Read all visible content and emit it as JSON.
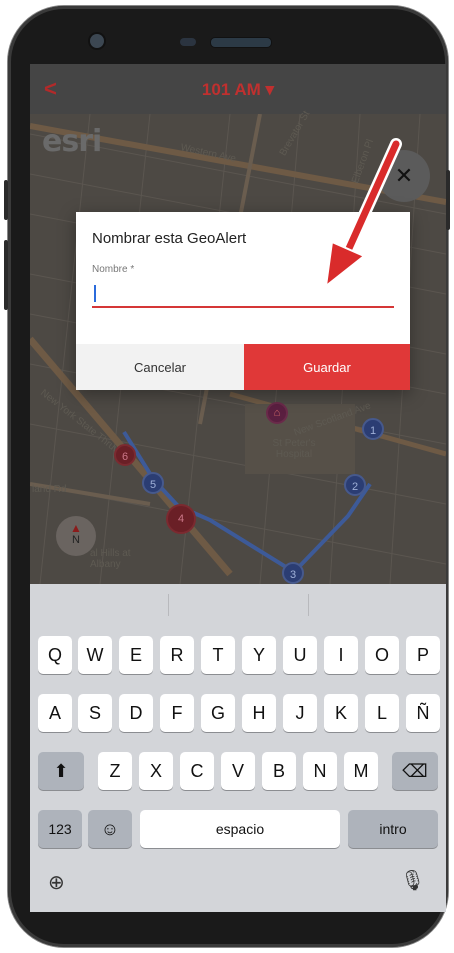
{
  "app_bar": {
    "back_icon": "chevron-left-icon",
    "title": "101 AM ▾"
  },
  "map": {
    "brand": "esri",
    "labels": [
      {
        "text": "Western Ave",
        "rot": 12
      },
      {
        "text": "Brevator St",
        "rot": -60
      },
      {
        "text": "Elberon Pl",
        "rot": -70
      },
      {
        "text": "New York State Thruway",
        "rot": 38
      },
      {
        "text": "New Scotland Ave",
        "rot": -20
      },
      {
        "text": "St Peter's Hospital",
        "rot": 0
      },
      {
        "text": "land Rd",
        "rot": 0
      },
      {
        "text": "al Hills at Albany",
        "rot": 0
      }
    ],
    "route_markers": [
      "1",
      "2",
      "3",
      "4",
      "5",
      "6"
    ],
    "compass_letter": "N",
    "tool_icon": "tools-icon"
  },
  "dialog": {
    "title": "Nombrar esta GeoAlert",
    "field_label": "Nombre *",
    "field_value": "",
    "cancel_label": "Cancelar",
    "save_label": "Guardar",
    "accent_color": "#e03838"
  },
  "keyboard": {
    "row1": [
      "Q",
      "W",
      "E",
      "R",
      "T",
      "Y",
      "U",
      "I",
      "O",
      "P"
    ],
    "row2": [
      "A",
      "S",
      "D",
      "F",
      "G",
      "H",
      "J",
      "K",
      "L",
      "Ñ"
    ],
    "row3": [
      "Z",
      "X",
      "C",
      "V",
      "B",
      "N",
      "M"
    ],
    "shift_icon": "shift-icon",
    "backspace_icon": "backspace-icon",
    "numbers_label": "123",
    "emoji_icon": "emoji-icon",
    "space_label": "espacio",
    "return_label": "intro",
    "globe_icon": "globe-icon",
    "mic_icon": "microphone-icon"
  }
}
